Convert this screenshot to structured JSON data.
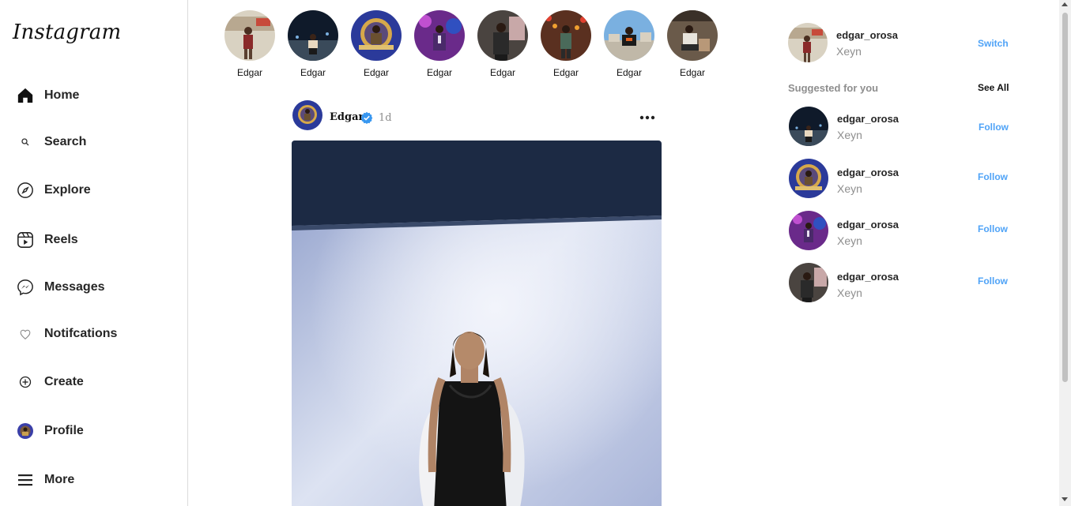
{
  "app": {
    "logo": "Instagram"
  },
  "sidebar": {
    "items": [
      {
        "label": "Home",
        "icon": "home-icon"
      },
      {
        "label": "Search",
        "icon": "search-icon"
      },
      {
        "label": "Explore",
        "icon": "compass-icon"
      },
      {
        "label": "Reels",
        "icon": "reels-icon"
      },
      {
        "label": "Messages",
        "icon": "messenger-icon"
      },
      {
        "label": "Notifcations",
        "icon": "heart-icon"
      },
      {
        "label": "Create",
        "icon": "plus-circle-icon"
      },
      {
        "label": "Profile",
        "icon": "profile-avatar"
      },
      {
        "label": "More",
        "icon": "hamburger-icon"
      }
    ]
  },
  "stories": [
    {
      "name": "Edgar"
    },
    {
      "name": "Edgar"
    },
    {
      "name": "Edgar"
    },
    {
      "name": "Edgar"
    },
    {
      "name": "Edgar"
    },
    {
      "name": "Edgar"
    },
    {
      "name": "Edgar"
    },
    {
      "name": "Edgar"
    }
  ],
  "post": {
    "username": "Edgar",
    "verified": true,
    "time": "1d",
    "more_icon": "more-dots-icon"
  },
  "current_user": {
    "username": "edgar_orosa",
    "name": "Xeyn",
    "action": "Switch"
  },
  "suggestions": {
    "heading": "Suggested for you",
    "see_all": "See All",
    "items": [
      {
        "username": "edgar_orosa",
        "name": "Xeyn",
        "action": "Follow"
      },
      {
        "username": "edgar_orosa",
        "name": "Xeyn",
        "action": "Follow"
      },
      {
        "username": "edgar_orosa",
        "name": "Xeyn",
        "action": "Follow"
      },
      {
        "username": "edgar_orosa",
        "name": "Xeyn",
        "action": "Follow"
      }
    ]
  },
  "colors": {
    "link": "#4fa3f7",
    "verified": "#3897f0",
    "muted": "#8e8e8e",
    "border": "#dbdbdb"
  }
}
